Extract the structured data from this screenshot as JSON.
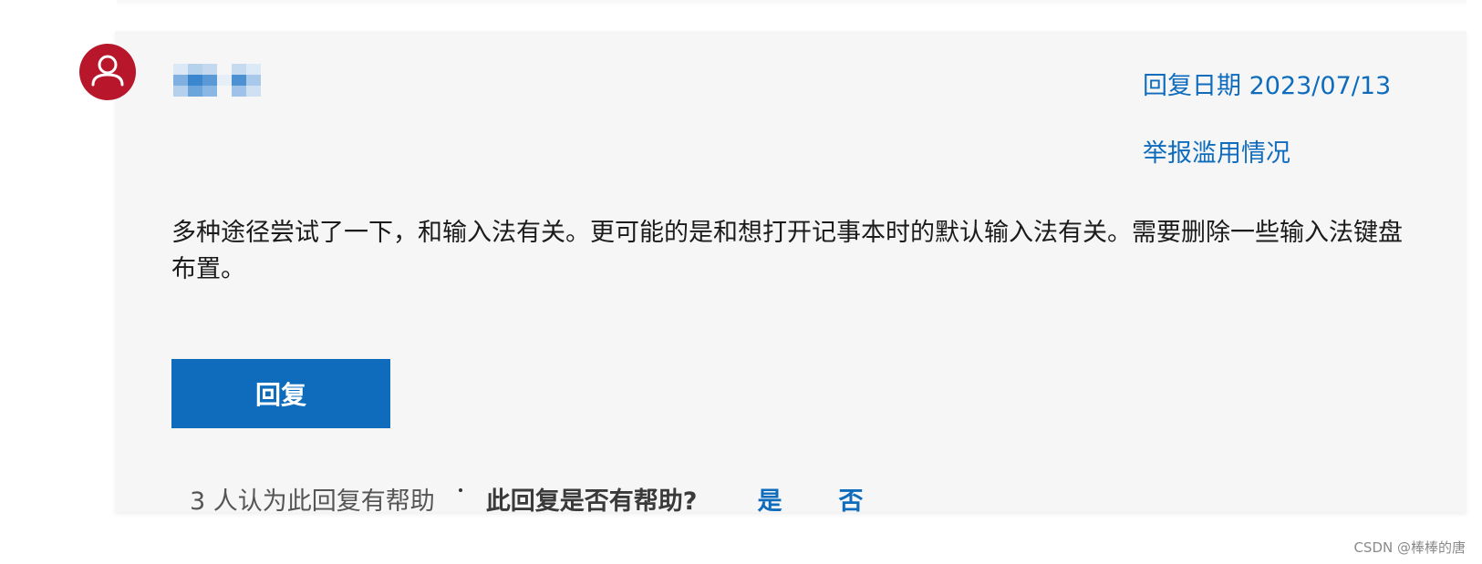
{
  "post": {
    "username_obscured": true,
    "reply_date_label": "回复日期 2023/07/13",
    "report_label": "举报滥用情况",
    "body": "多种途径尝试了一下，和输入法有关。更可能的是和想打开记事本时的默认输入法有关。需要删除一些输入法键盘布置。",
    "reply_button_label": "回复"
  },
  "feedback": {
    "helpful_count_text": "3 人认为此回复有帮助",
    "question": "此回复是否有帮助?",
    "yes_label": "是",
    "no_label": "否"
  },
  "watermark": "CSDN @棒棒的唐",
  "colors": {
    "accent": "#0f6cbd",
    "avatar": "#b8162a",
    "card_background": "#f6f6f6"
  },
  "icons": {
    "avatar": "user-avatar-icon"
  }
}
